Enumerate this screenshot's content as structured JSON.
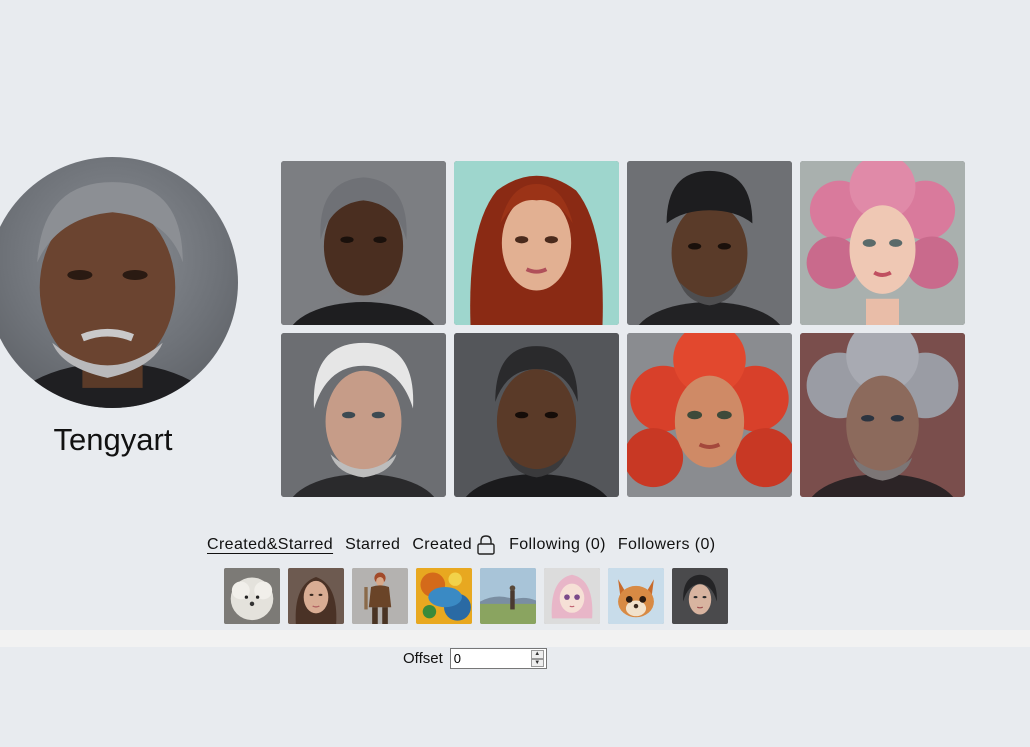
{
  "profile": {
    "username": "Tengyart"
  },
  "tabs": [
    {
      "label": "Created&Starred",
      "active": true
    },
    {
      "label": "Starred",
      "active": false
    },
    {
      "label": "Created",
      "active": false,
      "icon": "lock-icon"
    },
    {
      "label": "Following (0)",
      "active": false
    },
    {
      "label": "Followers (0)",
      "active": false
    }
  ],
  "offset": {
    "label": "Offset",
    "value": "0"
  },
  "portraits": [
    "older dark-skinned man with grey hair",
    "woman with long red hair",
    "man wearing black cap",
    "woman with pink curly hair",
    "old man with white hair",
    "dark-skinned man with short dark hair",
    "girl with curly red hair",
    "old man with grey curly hair"
  ],
  "thumbnails": [
    "white fluffy dog",
    "brown-haired woman",
    "fantasy warrior woman",
    "colorful fish art",
    "landscape with figure",
    "anime girl with pink hair",
    "cartoon fox",
    "dark-haired woman"
  ]
}
